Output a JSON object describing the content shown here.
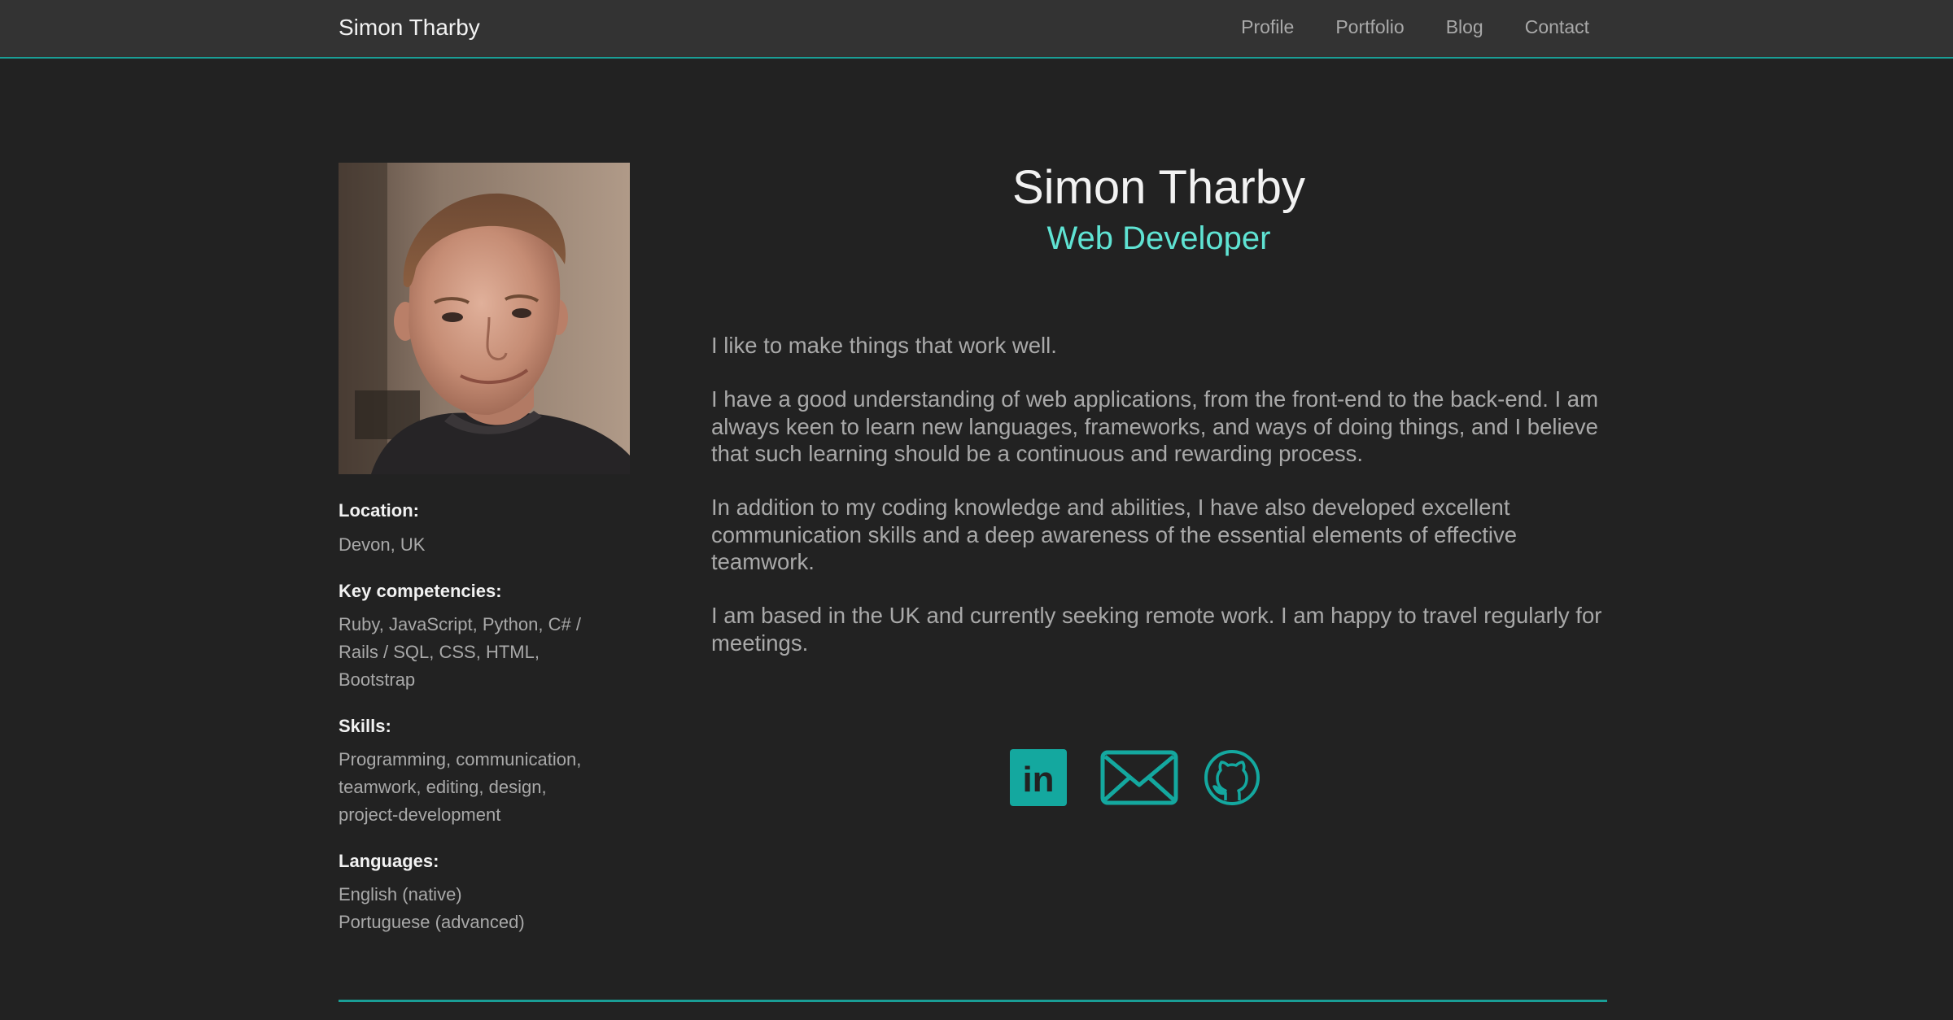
{
  "header": {
    "brand": "Simon Tharby",
    "nav": [
      "Profile",
      "Portfolio",
      "Blog",
      "Contact"
    ]
  },
  "sidebar": {
    "photo_alt": "Portrait photo of Simon Tharby",
    "location_label": "Location:",
    "location_value": "Devon, UK",
    "competencies_label": "Key competencies:",
    "competencies_value": "Ruby, JavaScript, Python, C# / Rails / SQL, CSS, HTML, Bootstrap",
    "skills_label": "Skills:",
    "skills_value": "Programming, communication, teamwork, editing, design, project-development",
    "languages_label": "Languages:",
    "languages": [
      "English (native)",
      "Portuguese (advanced)"
    ]
  },
  "main": {
    "name": "Simon Tharby",
    "role": "Web Developer",
    "bio": [
      "I like to make things that work well.",
      "I have a good understanding of web applications, from the front-end to the back-end. I am always keen to learn new languages, frameworks, and ways of doing things, and I believe that such learning should be a continuous and rewarding process.",
      "In addition to my coding knowledge and abilities, I have also developed excellent communication skills and a deep awareness of the essential elements of effective teamwork.",
      "I am based in the UK and currently seeking remote work. I am happy to travel regularly for meetings."
    ]
  },
  "social": {
    "icons": [
      "linkedin-icon",
      "email-icon",
      "github-icon"
    ],
    "linkedin_text": "in"
  },
  "colors": {
    "background": "#222222",
    "navbar": "#333333",
    "accent": "#1a9e96",
    "role_text": "#5fe3d3",
    "icon": "#14a89f",
    "heading_text": "#f2f2f2",
    "body_text": "#a9a9a9"
  }
}
